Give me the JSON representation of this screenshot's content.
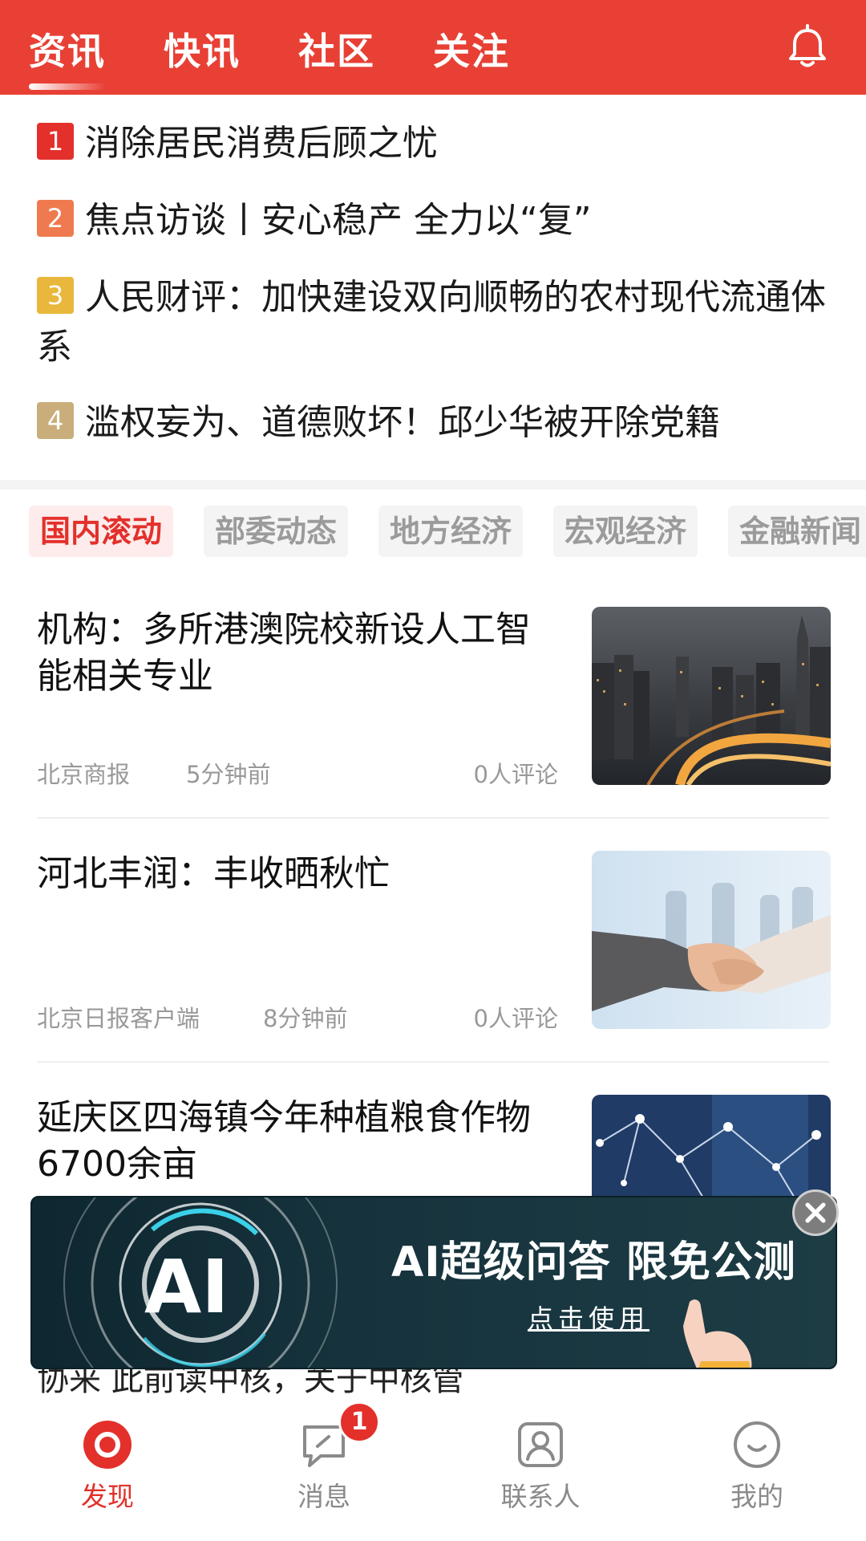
{
  "header": {
    "tabs": [
      {
        "label": "资讯",
        "active": true
      },
      {
        "label": "快讯",
        "active": false
      },
      {
        "label": "社区",
        "active": false
      },
      {
        "label": "关注",
        "active": false
      }
    ],
    "bell_icon": "bell-icon",
    "accent_color": "#e84035"
  },
  "hot_list": [
    {
      "rank": "1",
      "title": "消除居民消费后顾之忧"
    },
    {
      "rank": "2",
      "title": "焦点访谈丨安心稳产 全力以“复”"
    },
    {
      "rank": "3",
      "title": "人民财评：加快建设双向顺畅的农村现代流通体系"
    },
    {
      "rank": "4",
      "title": "滥权妄为、道德败坏！邱少华被开除党籍"
    }
  ],
  "categories": [
    {
      "label": "国内滚动",
      "active": true
    },
    {
      "label": "部委动态",
      "active": false
    },
    {
      "label": "地方经济",
      "active": false
    },
    {
      "label": "宏观经济",
      "active": false
    },
    {
      "label": "金融新闻",
      "active": false
    }
  ],
  "articles": [
    {
      "title": "机构：多所港澳院校新设人工智能相关专业",
      "source": "北京商报",
      "time": "5分钟前",
      "comments": "0人评论",
      "image": "city-night-highway"
    },
    {
      "title": "河北丰润：丰收晒秋忙",
      "source": "北京日报客户端",
      "time": "8分钟前",
      "comments": "0人评论",
      "image": "handshake"
    },
    {
      "title": "延庆区四海镇今年种植粮食作物6700余亩",
      "source": "",
      "time": "",
      "comments": "",
      "image": "network-business"
    }
  ],
  "peek_article": {
    "title": "协来 此前读中核，关于中核管"
  },
  "ad": {
    "logo_text": "AI",
    "headline": "AI超级问答 限免公测",
    "cta": "点击使用",
    "close_icon": "close-icon"
  },
  "bottom_nav": [
    {
      "label": "发现",
      "icon": "discover-icon",
      "active": true
    },
    {
      "label": "消息",
      "icon": "message-icon",
      "active": false,
      "badge": "1"
    },
    {
      "label": "联系人",
      "icon": "contacts-icon",
      "active": false
    },
    {
      "label": "我的",
      "icon": "profile-icon",
      "active": false
    }
  ]
}
